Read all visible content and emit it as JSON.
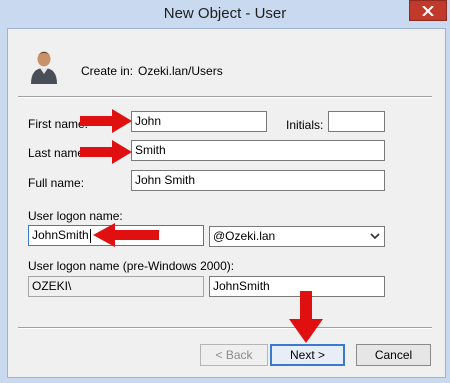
{
  "window": {
    "title": "New Object - User"
  },
  "header": {
    "create_in_label": "Create in:",
    "create_in_value": "Ozeki.lan/Users"
  },
  "form": {
    "first_name_label": "First name:",
    "first_name_value": "John",
    "initials_label": "Initials:",
    "initials_value": "",
    "last_name_label": "Last name:",
    "last_name_value": "Smith",
    "full_name_label": "Full name:",
    "full_name_value": "John Smith",
    "logon_label": "User logon name:",
    "logon_value": "JohnSmith",
    "domain_value": "@Ozeki.lan",
    "pre2000_label": "User logon name (pre-Windows 2000):",
    "pre2000_domain_value": "OZEKI\\",
    "pre2000_name_value": "JohnSmith"
  },
  "buttons": {
    "back": "< Back",
    "next": "Next >",
    "cancel": "Cancel"
  },
  "colors": {
    "arrow": "#e01010",
    "focus": "#3a79d1",
    "close": "#c0392b"
  }
}
